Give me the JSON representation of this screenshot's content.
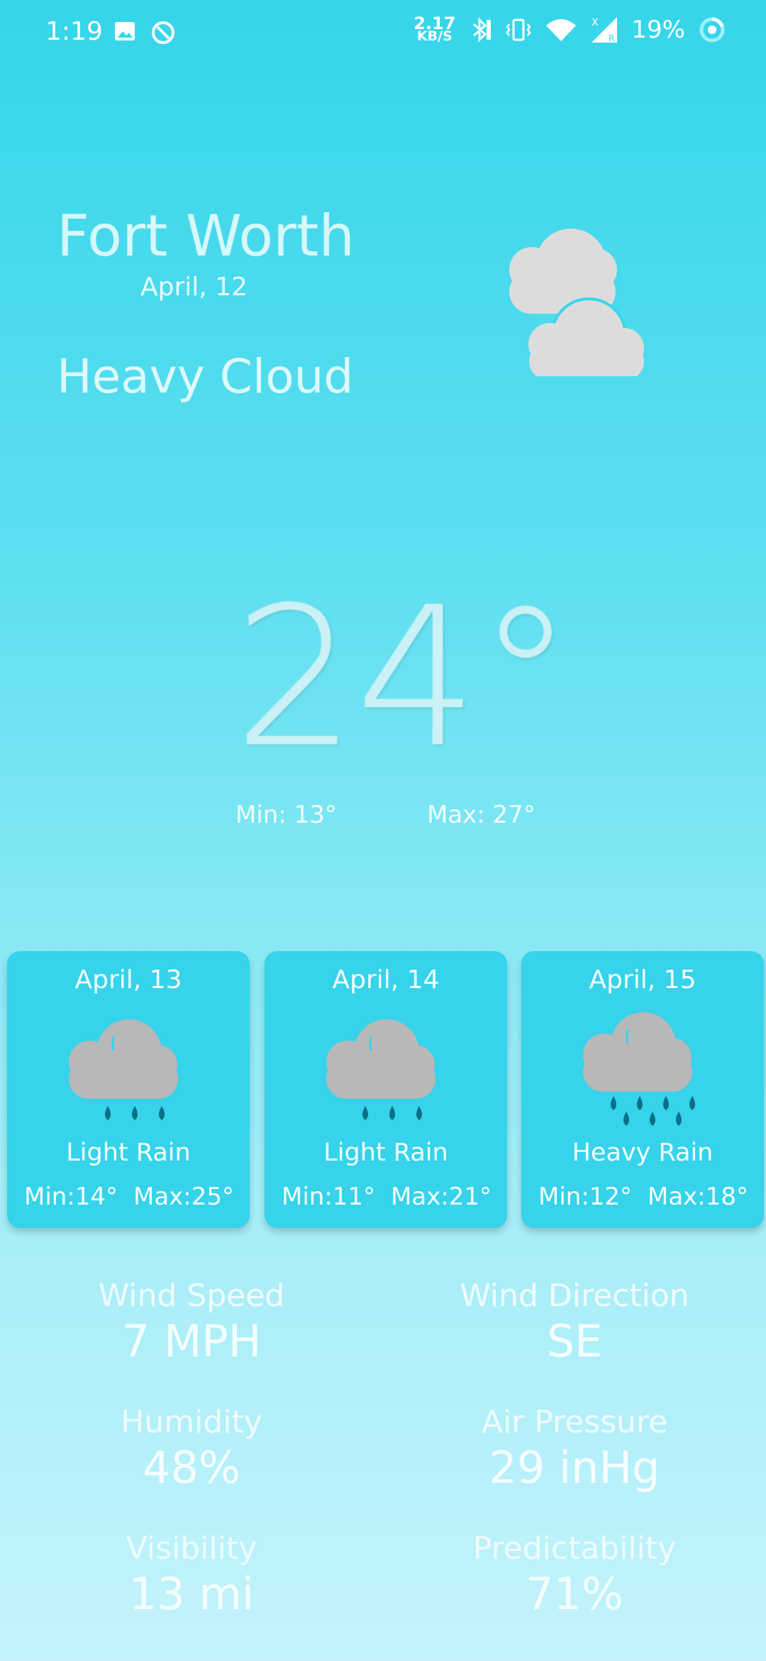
{
  "status_bar": {
    "time": "1:19",
    "net_speed_value": "2.17",
    "net_speed_unit": "KB/S",
    "battery": "19%"
  },
  "current": {
    "city": "Fort Worth",
    "date": "April, 12",
    "condition": "Heavy Cloud",
    "temperature": "24°",
    "min": "Min: 13°",
    "max": "Max: 27°",
    "icon": "heavy-cloud-icon"
  },
  "forecast": [
    {
      "date": "April, 13",
      "condition": "Light Rain",
      "min": "Min:14°",
      "max": "Max:25°",
      "icon": "light-rain-icon"
    },
    {
      "date": "April, 14",
      "condition": "Light Rain",
      "min": "Min:11°",
      "max": "Max:21°",
      "icon": "light-rain-icon"
    },
    {
      "date": "April, 15",
      "condition": "Heavy Rain",
      "min": "Min:12°",
      "max": "Max:18°",
      "icon": "heavy-rain-icon"
    }
  ],
  "details": {
    "wind_speed_label": "Wind Speed",
    "wind_speed_value": "7 MPH",
    "wind_direction_label": "Wind Direction",
    "wind_direction_value": "SE",
    "humidity_label": "Humidity",
    "humidity_value": "48%",
    "air_pressure_label": "Air Pressure",
    "air_pressure_value": "29 inHg",
    "visibility_label": "Visibility",
    "visibility_value": "13 mi",
    "predictability_label": "Predictability",
    "predictability_value": "71%"
  },
  "colors": {
    "background_top": "#35d5ea",
    "background_bottom": "#c4f3fb",
    "card": "#36d3eb",
    "cloud_gray": "#b8b8b8",
    "raindrop": "#0b6f86"
  }
}
